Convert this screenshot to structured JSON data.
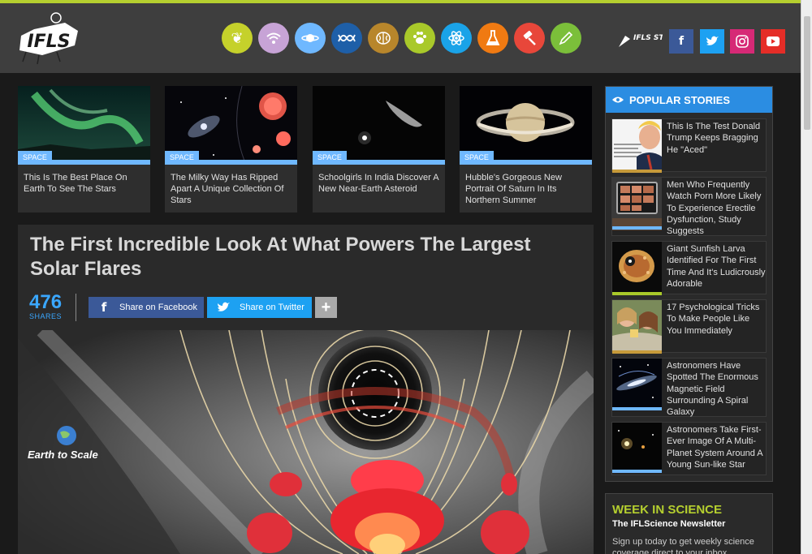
{
  "header": {
    "logo_text": "IFLS",
    "store_text": "IFLS STORE",
    "categories": [
      {
        "name": "environment",
        "icon": "leaf-icon",
        "color": "#c5d12b"
      },
      {
        "name": "technology",
        "icon": "wifi-icon",
        "color": "#c7a3d6"
      },
      {
        "name": "space",
        "icon": "planet-icon",
        "color": "#6fb8ff"
      },
      {
        "name": "genetics",
        "icon": "dna-icon",
        "color": "#1e5fa8"
      },
      {
        "name": "brain",
        "icon": "brain-icon",
        "color": "#b8862b"
      },
      {
        "name": "plants-and-animals",
        "icon": "paw-icon",
        "color": "#a9c92a"
      },
      {
        "name": "physics",
        "icon": "atom-icon",
        "color": "#1aa3e8"
      },
      {
        "name": "chemistry",
        "icon": "flask-icon",
        "color": "#f07a12"
      },
      {
        "name": "policy",
        "icon": "gavel-icon",
        "color": "#e8473a"
      },
      {
        "name": "editors-blog",
        "icon": "pencil-icon",
        "color": "#7bbf3a"
      }
    ],
    "social": [
      {
        "name": "facebook",
        "glyph": "f",
        "color": "#3b5998"
      },
      {
        "name": "twitter",
        "glyph": "t",
        "color": "#1da1f2"
      },
      {
        "name": "instagram",
        "glyph": "◎",
        "color": "#d62976"
      },
      {
        "name": "youtube",
        "glyph": "▶",
        "color": "#e52d27"
      }
    ]
  },
  "cards": [
    {
      "tag": "SPACE",
      "title": "This Is The Best Place On Earth To See The Stars"
    },
    {
      "tag": "SPACE",
      "title": "The Milky Way Has Ripped Apart A Unique Collection Of Stars"
    },
    {
      "tag": "SPACE",
      "title": "Schoolgirls In India Discover A New Near-Earth Asteroid"
    },
    {
      "tag": "SPACE",
      "title": "Hubble's Gorgeous New Portrait Of Saturn In Its Northern Summer"
    }
  ],
  "article": {
    "title": "The First Incredible Look At What Powers The Largest Solar Flares",
    "share_count": "476",
    "share_label": "SHARES",
    "facebook_label": "Share on Facebook",
    "twitter_label": "Share on Twitter",
    "more_label": "+",
    "image_label": "Earth to Scale"
  },
  "popular": {
    "heading": "POPULAR STORIES",
    "items": [
      {
        "title": "This Is The Test Donald Trump Keeps Bragging He \"Aced\"",
        "bar_color": "#c69a3a"
      },
      {
        "title": "Men Who Frequently Watch Porn More Likely To Experience Erectile Dysfunction, Study Suggests",
        "bar_color": "#6fb8ff"
      },
      {
        "title": "Giant Sunfish Larva Identified For The First Time And It's Ludicrously Adorable",
        "bar_color": "#a9c92a"
      },
      {
        "title": "17 Psychological Tricks To Make People Like You Immediately",
        "bar_color": "#c69a3a"
      },
      {
        "title": "Astronomers Have Spotted The Enormous Magnetic Field Surrounding A Spiral Galaxy",
        "bar_color": "#6fb8ff"
      },
      {
        "title": "Astronomers Take First-Ever Image Of A Multi-Planet System Around A Young Sun-like Star",
        "bar_color": "#6fb8ff"
      }
    ]
  },
  "newsletter": {
    "title": "WEEK IN SCIENCE",
    "subtitle": "The IFLScience Newsletter",
    "text": "Sign up today to get weekly science coverage direct to your inbox"
  }
}
